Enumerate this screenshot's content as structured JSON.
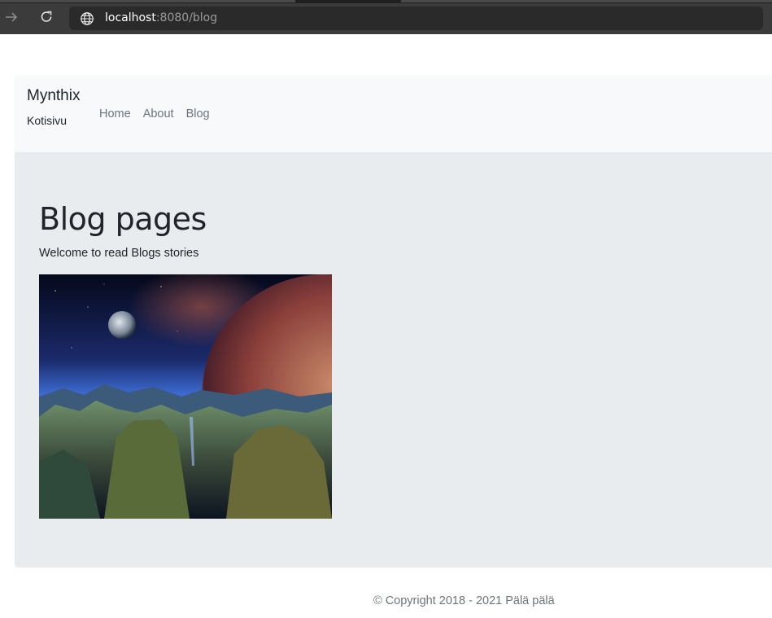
{
  "browser": {
    "url_host": "localhost",
    "url_rest": ":8080/blog"
  },
  "navbar": {
    "brand": "Mynthix",
    "subtitle": "Kotisivu",
    "links": [
      {
        "label": "Home"
      },
      {
        "label": "About"
      },
      {
        "label": "Blog"
      }
    ]
  },
  "main": {
    "title": "Blog pages",
    "lead": "Welcome to read Blogs stories"
  },
  "footer": {
    "copyright": "© Copyright 2018 - 2021 Pälä pälä"
  },
  "colors": {
    "chrome_bg": "#3b3b3b",
    "address_bg": "#2a2a2a",
    "navbar_bg": "#f8f9fa",
    "jumbotron_bg": "#e9ecef",
    "muted_text": "#6c757d",
    "body_text": "#212529"
  }
}
